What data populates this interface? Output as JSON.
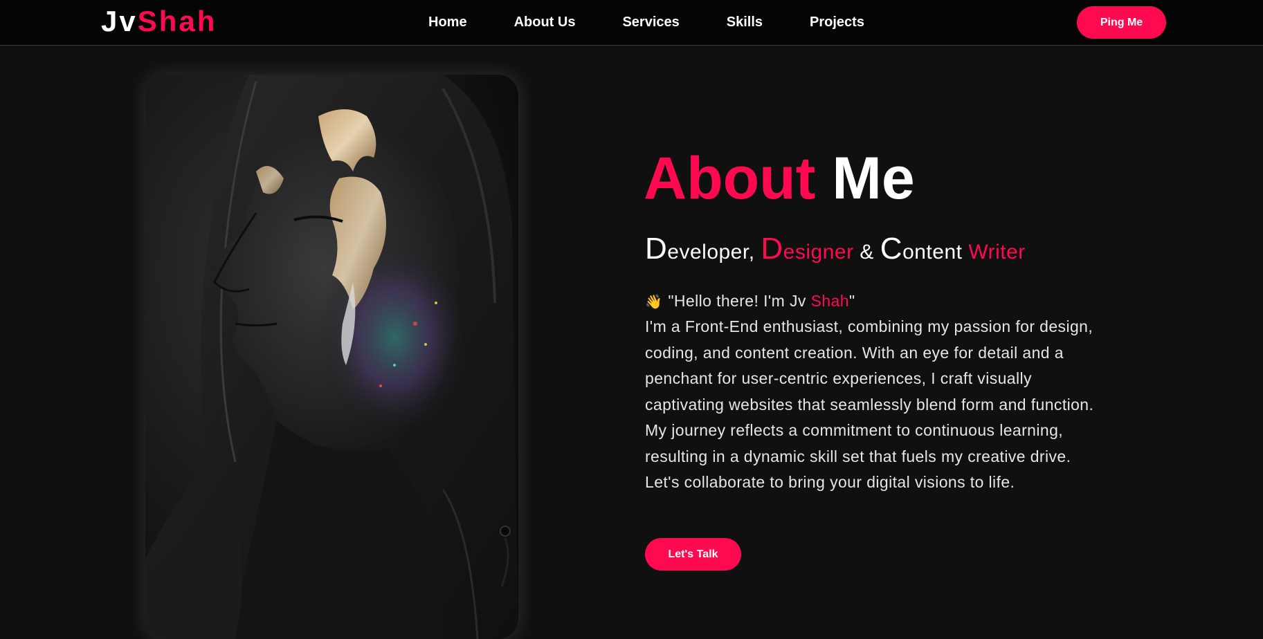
{
  "brand": {
    "logo_first": "Jv",
    "logo_second": "Shah"
  },
  "nav": {
    "items": [
      {
        "label": "Home"
      },
      {
        "label": "About Us"
      },
      {
        "label": "Services"
      },
      {
        "label": "Skills"
      },
      {
        "label": "Projects"
      }
    ],
    "cta_label": "Ping Me"
  },
  "about": {
    "title_first": "About",
    "title_second": "Me",
    "roles": {
      "role1_cap": "D",
      "role1_rest": "eveloper,",
      "role2_cap": "D",
      "role2_rest": "esigner",
      "amp": "&",
      "role3_cap": "C",
      "role3_rest": "ontent",
      "role3_tail": "Writer"
    },
    "greeting": {
      "emoji": "👋",
      "prefix": "\"Hello there! I'm Jv ",
      "name": "Shah",
      "suffix": "\""
    },
    "bio_lines": [
      "I'm a Front-End enthusiast, combining my passion for design,",
      "coding, and content creation. With an eye for detail and a",
      "penchant for user-centric experiences, I craft visually",
      "captivating websites that seamlessly blend form and function.",
      "My journey reflects a commitment to continuous learning,",
      "resulting in a dynamic skill set that fuels my creative drive.",
      "Let's collaborate to bring your digital visions to life."
    ],
    "cta_label": "Let's Talk"
  },
  "colors": {
    "accent": "#ff0a50",
    "background": "#101010",
    "header": "#050505",
    "text": "#ffffff"
  }
}
